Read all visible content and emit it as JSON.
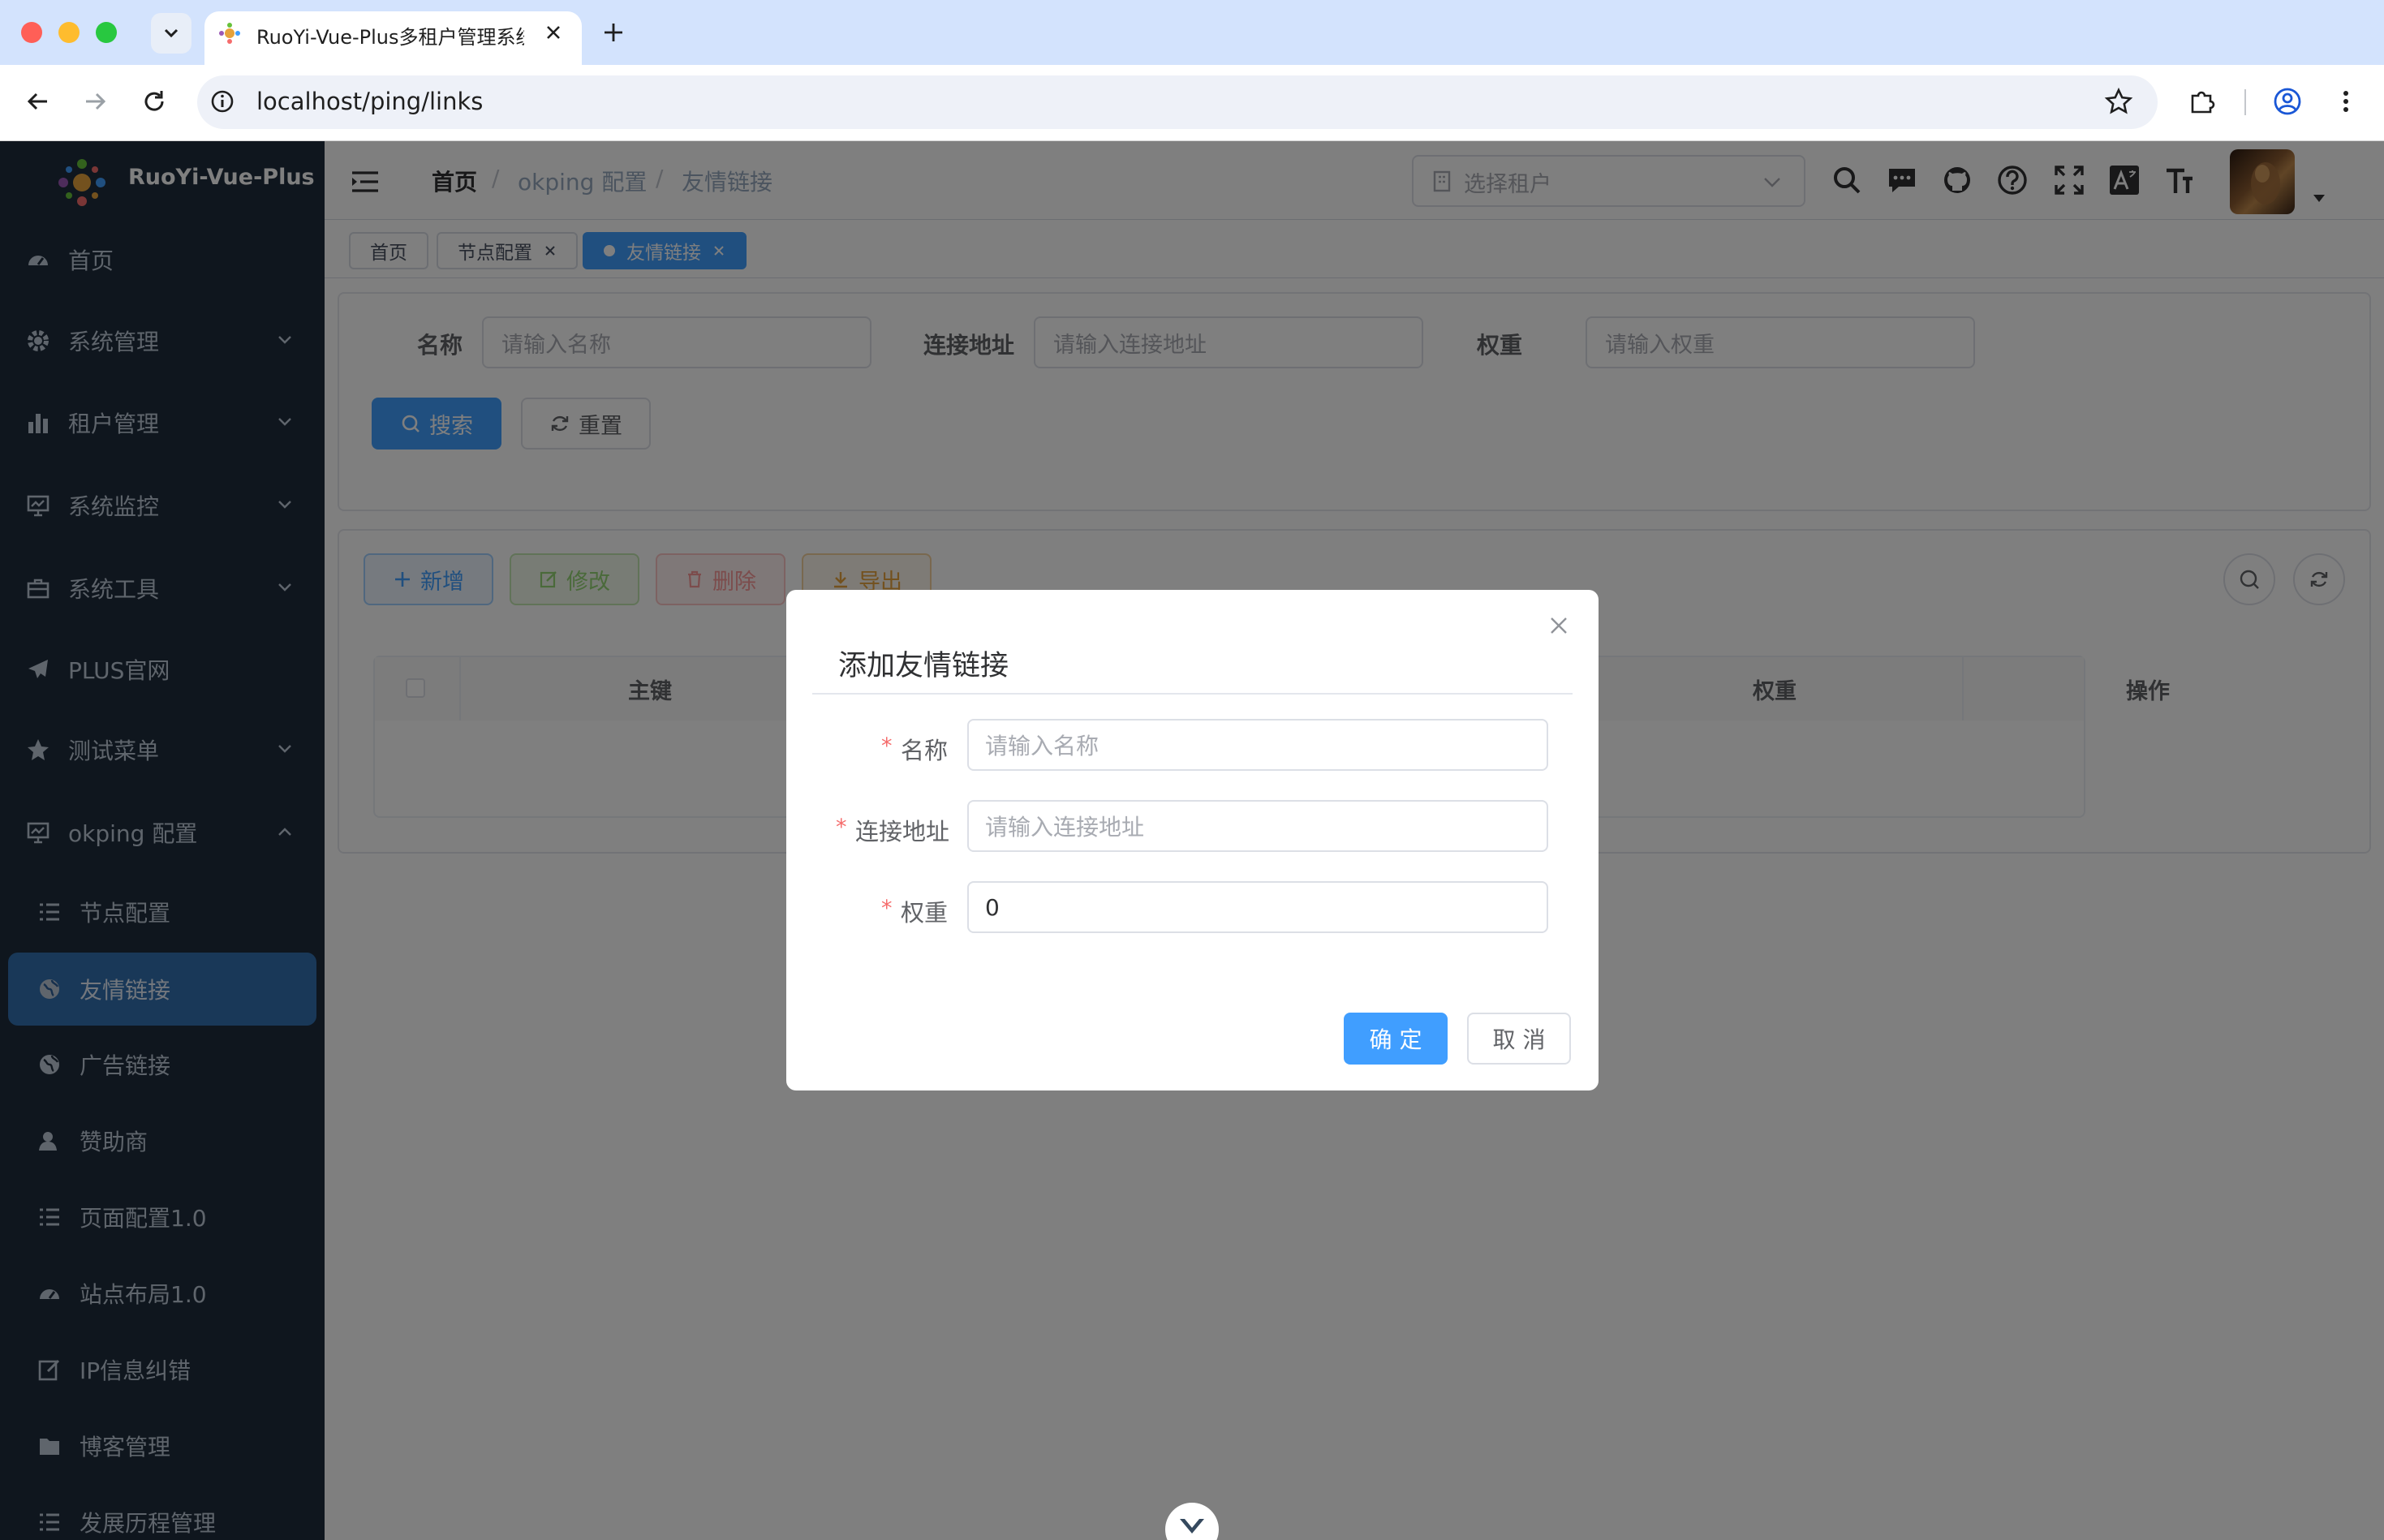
{
  "browser": {
    "tab_title": "RuoYi-Vue-Plus多租户管理系统",
    "url": "localhost/ping/links"
  },
  "app": {
    "brand": "RuoYi-Vue-Plus",
    "accent_color": "#409eff",
    "sidebar_bg": "#1f2d3d"
  },
  "sidebar": {
    "items": [
      {
        "label": "首页",
        "icon": "dashboard-icon"
      },
      {
        "label": "系统管理",
        "icon": "gear-icon"
      },
      {
        "label": "租户管理",
        "icon": "bar-chart-icon"
      },
      {
        "label": "系统监控",
        "icon": "monitor-icon"
      },
      {
        "label": "系统工具",
        "icon": "toolbox-icon"
      },
      {
        "label": "PLUS官网",
        "icon": "paper-plane-icon"
      },
      {
        "label": "测试菜单",
        "icon": "star-icon"
      },
      {
        "label": "okping 配置",
        "icon": "monitor-icon"
      }
    ],
    "sub_items": [
      {
        "label": "节点配置",
        "icon": "list-icon"
      },
      {
        "label": "友情链接",
        "icon": "globe-icon"
      },
      {
        "label": "广告链接",
        "icon": "globe-icon"
      },
      {
        "label": "赞助商",
        "icon": "user-icon"
      },
      {
        "label": "页面配置1.0",
        "icon": "list-icon"
      },
      {
        "label": "站点布局1.0",
        "icon": "dashboard-icon"
      },
      {
        "label": "IP信息纠错",
        "icon": "edit-icon"
      },
      {
        "label": "博客管理",
        "icon": "folder-icon"
      },
      {
        "label": "发展历程管理",
        "icon": "list-icon"
      }
    ]
  },
  "header": {
    "breadcrumb": [
      "首页",
      "/",
      "okping 配置",
      "/",
      "友情链接"
    ],
    "tenant_placeholder": "选择租户"
  },
  "tags": [
    "首页",
    "节点配置",
    "友情链接"
  ],
  "search": {
    "name_label": "名称",
    "name_placeholder": "请输入名称",
    "url_label": "连接地址",
    "url_placeholder": "请输入连接地址",
    "weight_label": "权重",
    "weight_placeholder": "请输入权重",
    "search_btn": "搜索",
    "reset_btn": "重置"
  },
  "toolbar": {
    "add": "新增",
    "edit": "修改",
    "delete": "删除",
    "export": "导出"
  },
  "table": {
    "columns": [
      "主键",
      "权重",
      "操作"
    ]
  },
  "dialog": {
    "title": "添加友情链接",
    "asterisk": "*",
    "name_label": "名称",
    "name_placeholder": "请输入名称",
    "url_label": "连接地址",
    "url_placeholder": "请输入连接地址",
    "weight_label": "权重",
    "weight_value": "0",
    "confirm": "确 定",
    "cancel": "取 消"
  }
}
